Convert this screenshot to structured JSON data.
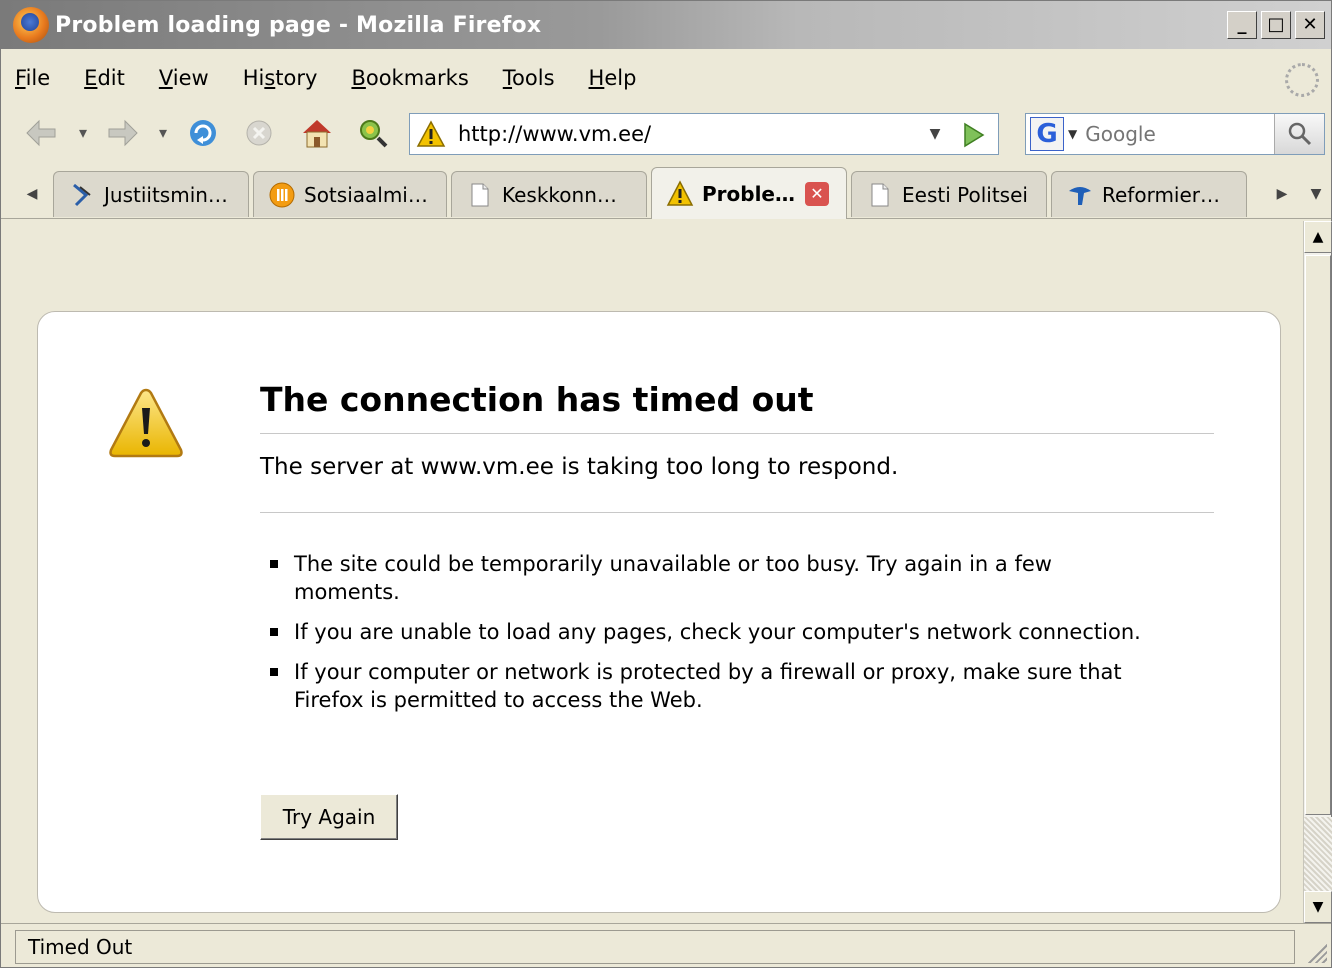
{
  "window": {
    "title": "Problem loading page - Mozilla Firefox",
    "minimize": "_",
    "maximize": "□",
    "close": "✕"
  },
  "menu": {
    "items": [
      {
        "label": "File"
      },
      {
        "label": "Edit"
      },
      {
        "label": "View"
      },
      {
        "label": "History"
      },
      {
        "label": "Bookmarks"
      },
      {
        "label": "Tools"
      },
      {
        "label": "Help"
      }
    ]
  },
  "navbar": {
    "url": "http://www.vm.ee/",
    "search_placeholder": "Google",
    "icons": [
      "back-icon",
      "forward-icon",
      "reload-icon",
      "stop-icon",
      "home-icon",
      "addon-icon"
    ]
  },
  "tabs": [
    {
      "label": "Justiitsmin…",
      "icon": "justice-icon",
      "active": false
    },
    {
      "label": "Sotsiaalmi…",
      "icon": "social-icon",
      "active": false
    },
    {
      "label": "Keskkonn…",
      "icon": "page-icon",
      "active": false
    },
    {
      "label": "Proble…",
      "icon": "warning-icon",
      "active": true
    },
    {
      "label": "Eesti Politsei",
      "icon": "page-icon",
      "active": false
    },
    {
      "label": "Reformier…",
      "icon": "reform-icon",
      "active": false
    }
  ],
  "error": {
    "title": "The connection has timed out",
    "description": "The server at www.vm.ee is taking too long to respond.",
    "bullets": [
      "The site could be temporarily unavailable or too busy. Try again in a few moments.",
      "If you are unable to load any pages, check your computer's network connection.",
      "If your computer or network is protected by a firewall or proxy, make sure that Firefox is permitted to access the Web."
    ],
    "button": "Try Again"
  },
  "status": {
    "text": "Timed Out"
  },
  "colors": {
    "chrome": "#ece9d8",
    "title_gradient_start": "#7a7a7a",
    "warning_yellow": "#f2c200"
  }
}
